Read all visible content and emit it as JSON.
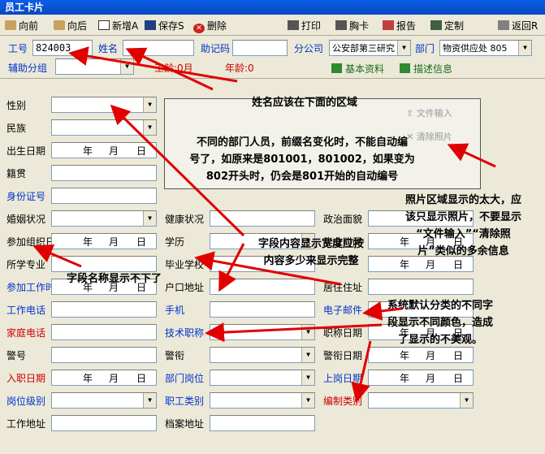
{
  "window": {
    "title": "员工卡片"
  },
  "toolbar": {
    "prev": "向前",
    "next": "向后",
    "new": "新增A",
    "save": "保存S",
    "delete": "删除",
    "print": "打印",
    "chest_card": "胸卡",
    "report": "报告",
    "custom": "定制",
    "back": "返回R"
  },
  "header": {
    "emp_no_label": "工号",
    "emp_no_value": "824003",
    "name_label": "姓名",
    "name_value": "",
    "mnemonic_label": "助记码",
    "mnemonic_value": "",
    "branch_label": "分公司",
    "branch_value": "公安部第三研究",
    "dept_label": "部门",
    "dept_value": "物资供应处 805",
    "aux_group_label": "辅助分组",
    "aux_group_value": "",
    "seniority": "工龄:0月",
    "age": "年龄:0",
    "basic_info": "基本资料",
    "description_info": "描述信息"
  },
  "photo": {
    "file_input": "文件输入",
    "clear_photo": "清除照片"
  },
  "date_parts": {
    "year": "年",
    "month": "月",
    "day": "日"
  },
  "fields": {
    "gender": "性别",
    "ethnicity": "民族",
    "birth_date": "出生日期",
    "native_place": "籍贯",
    "id_card": "身份证号",
    "marital": "婚姻状况",
    "health": "健康状况",
    "political": "政治面貌",
    "join_org": "参加组织日",
    "education": "学历",
    "graduation_time": "毕业时间",
    "major": "所学专业",
    "school": "毕业学校",
    "join_work": "参加工作时",
    "hukou": "户口地址",
    "residence": "居住住址",
    "work_phone": "工作电话",
    "mobile": "手机",
    "email": "电子邮件",
    "home_phone": "家庭电话",
    "tech_title": "技术职称",
    "title_date": "职称日期",
    "police_no": "警号",
    "police_rank": "警衔",
    "rank_date": "警衔日期",
    "entry_date": "入职日期",
    "dept_post": "部门岗位",
    "post_date": "上岗日期",
    "post_level": "岗位级别",
    "staff_type": "职工类别",
    "establishment": "编制类别",
    "work_address": "工作地址",
    "archive_address": "档案地址"
  },
  "annotations": {
    "a1": "姓名应该在下面的区域",
    "a2_l1": "不同的部门人员，前缀名变化时，不能自动编",
    "a2_l2": "号了，如原来是801001，801002，如果变为",
    "a2_l3": "802开头时，仍会是801开始的自动编号",
    "a3_l1": "照片区域显示的太大，应",
    "a3_l2": "该只显示照片，不要显示",
    "a3_l3": "“文件输入”“清除照",
    "a3_l4": "片”类似的多余信息",
    "a4_l1": "字段内容显示宽度应按",
    "a4_l2": "内容多少来显示完整",
    "a5": "字段名称显示不下了",
    "a6_l1": "系统默认分类的不同字",
    "a6_l2": "段显示不同颜色，造成",
    "a6_l3": "了显示的不美观。"
  },
  "colors": {
    "field_blue": "#0033cc",
    "field_red": "#cc0000",
    "arrow": "#e00000"
  }
}
